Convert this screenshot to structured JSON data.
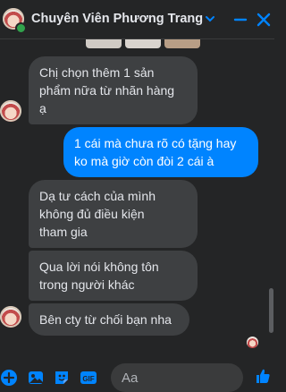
{
  "header": {
    "contact_name": "Chuyên Viên Phương Trang",
    "online": true
  },
  "messages": [
    {
      "direction": "in",
      "text": "Chị chọn thêm 1 sản\nphẩm nữa từ nhãn hàng\nạ"
    },
    {
      "direction": "out",
      "text": "1 cái mà chưa rõ có tặng hay\nko mà giờ còn đòi 2 cái à"
    },
    {
      "direction": "in",
      "text": "Dạ tư cách của mình\nkhông đủ điều kiện\ntham gia"
    },
    {
      "direction": "in",
      "text": "Qua lời nói không tôn\ntrong người khác"
    },
    {
      "direction": "in",
      "text": "Bên cty từ chối bạn nha"
    }
  ],
  "composer": {
    "placeholder": "Aa"
  },
  "colors": {
    "background": "#242526",
    "incoming_bubble": "#3e4042",
    "outgoing_bubble": "#0084ff",
    "accent": "#0084ff",
    "online": "#31a24c"
  },
  "icons": {
    "header": [
      "chevron-down-icon",
      "minimize-icon",
      "close-icon"
    ],
    "composer": [
      "plus-icon",
      "image-icon",
      "sticker-icon",
      "gif-icon",
      "emoji-icon",
      "like-icon"
    ]
  }
}
